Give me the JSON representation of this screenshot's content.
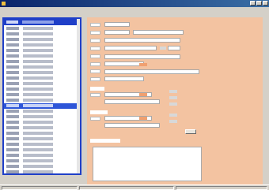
{
  "window": {
    "title": "",
    "accent": "#0a246a",
    "form_bg": "#f3c3a1",
    "list_border": "#1f3fc8"
  },
  "menu": [
    "",
    "",
    ""
  ],
  "list": {
    "header": [
      "",
      ""
    ],
    "rows": [
      [
        "",
        ""
      ],
      [
        "",
        ""
      ],
      [
        "",
        ""
      ],
      [
        "",
        ""
      ],
      [
        "",
        ""
      ],
      [
        "",
        ""
      ],
      [
        "",
        ""
      ],
      [
        "",
        ""
      ],
      [
        "",
        ""
      ],
      [
        "",
        ""
      ],
      [
        "",
        ""
      ],
      [
        "",
        ""
      ],
      [
        "",
        ""
      ],
      [
        "",
        ""
      ],
      [
        "",
        ""
      ],
      [
        "",
        ""
      ],
      [
        "",
        ""
      ],
      [
        "",
        ""
      ],
      [
        "",
        ""
      ],
      [
        "",
        ""
      ],
      [
        "",
        ""
      ],
      [
        "",
        ""
      ],
      [
        "",
        ""
      ],
      [
        "",
        ""
      ],
      [
        "",
        ""
      ],
      [
        "",
        ""
      ],
      [
        "",
        ""
      ]
    ],
    "selected_index": 14
  },
  "form": {
    "labels": [
      "",
      "",
      "",
      "",
      "",
      "",
      "",
      "",
      "",
      ""
    ],
    "fields": [
      "",
      "",
      "",
      "",
      "",
      "",
      "",
      "",
      "",
      "",
      ""
    ],
    "section_headers": [
      "",
      "",
      ""
    ],
    "buttons": [
      "",
      "",
      ""
    ]
  },
  "status": [
    "",
    "",
    ""
  ]
}
